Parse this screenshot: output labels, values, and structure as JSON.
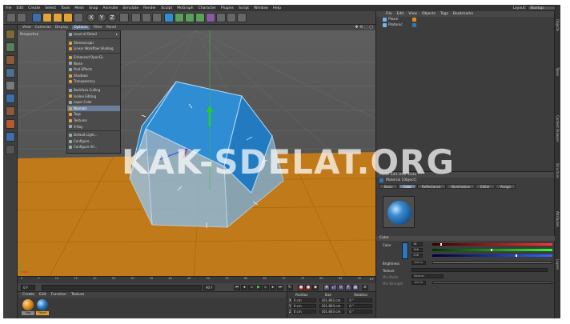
{
  "menubar": {
    "items": [
      "File",
      "Edit",
      "Create",
      "Select",
      "Tools",
      "Mesh",
      "Snap",
      "Animate",
      "Simulate",
      "Render",
      "Sculpt",
      "MoGraph",
      "Character",
      "Plugins",
      "Script",
      "Window",
      "Help"
    ],
    "layout_label": "Layout:",
    "layout_value": "Startup"
  },
  "toolbar": {
    "icons": [
      "undo-icon",
      "redo-icon",
      "select-icon",
      "move-icon",
      "scale-icon",
      "rotate-icon",
      "add-icon",
      "x-axis-icon",
      "y-axis-icon",
      "z-axis-icon",
      "coordinate-icon",
      "render-region-icon",
      "render-view-icon",
      "render-settings-icon",
      "cube-icon",
      "pen-icon",
      "subdivision-icon",
      "array-icon",
      "deformer-icon",
      "floor-icon",
      "camera-icon",
      "light-icon"
    ],
    "axis": [
      "X",
      "Y",
      "Z"
    ]
  },
  "viewport": {
    "menu": [
      "View",
      "Cameras",
      "Display",
      "Options",
      "Filter",
      "Panel"
    ],
    "active_menu": "Options",
    "label": "Perspective",
    "nav_icons": "✥ ⟲ ⬚ ▢"
  },
  "options_menu": {
    "items": [
      {
        "label": "Level of Detail",
        "check": false,
        "arrow": true,
        "sep_after": true
      },
      {
        "label": "Stereoscopic",
        "check": true,
        "sep_after": false
      },
      {
        "label": "Linear Workflow Shading",
        "check": true,
        "sep_after": true
      },
      {
        "label": "Enhanced OpenGL",
        "check": true,
        "sep_after": false
      },
      {
        "label": "Noise",
        "check": false,
        "sep_after": false
      },
      {
        "label": "Post Effects",
        "check": false,
        "sep_after": false
      },
      {
        "label": "Shadows",
        "check": true,
        "sep_after": false
      },
      {
        "label": "Transparency",
        "check": true,
        "sep_after": true
      },
      {
        "label": "Backface Culling",
        "check": false,
        "sep_after": false
      },
      {
        "label": "Isoline Editing",
        "check": true,
        "sep_after": false
      },
      {
        "label": "Layer Color",
        "check": false,
        "sep_after": false
      },
      {
        "label": "Normals",
        "check": true,
        "highlight": true,
        "sep_after": false
      },
      {
        "label": "Tags",
        "check": true,
        "sep_after": false
      },
      {
        "label": "Textures",
        "check": true,
        "sep_after": false
      },
      {
        "label": "X-Ray",
        "check": false,
        "sep_after": true
      },
      {
        "label": "Default Light...",
        "check": false,
        "sep_after": false
      },
      {
        "label": "Configure...",
        "check": false,
        "sep_after": false
      },
      {
        "label": "Configure All...",
        "check": false,
        "sep_after": false
      }
    ]
  },
  "timeline": {
    "ticks": [
      "0",
      "5",
      "10",
      "15",
      "20",
      "25",
      "30",
      "35",
      "40",
      "45",
      "50",
      "55",
      "60",
      "65",
      "70",
      "75",
      "80",
      "85",
      "90"
    ],
    "start_field": "0 F",
    "end_field": "90 F",
    "current_field": "0 F",
    "end2_field": "90 F",
    "current_frame_display": "0 F"
  },
  "material_manager": {
    "menu": [
      "Create",
      "Edit",
      "Function",
      "Texture"
    ],
    "materials": [
      {
        "label": "Mat",
        "color": "#e08a1e"
      },
      {
        "label": "Object",
        "color": "#2b78bf"
      }
    ]
  },
  "coordinates": {
    "headers": [
      "Position",
      "Size",
      "Rotation"
    ],
    "rows": [
      {
        "axis": "X",
        "pos": "0 cm",
        "size": "161.803 cm",
        "rot_label": "H",
        "rot": "0 °"
      },
      {
        "axis": "Y",
        "pos": "0 cm",
        "size": "161.803 cm",
        "rot_label": "P",
        "rot": "0 °"
      },
      {
        "axis": "Z",
        "pos": "0 cm",
        "size": "161.803 cm",
        "rot_label": "B",
        "rot": "0 °"
      }
    ]
  },
  "object_manager": {
    "menu": [
      "File",
      "Edit",
      "View",
      "Objects",
      "Tags",
      "Bookmarks"
    ],
    "objects": [
      {
        "label": "Plane",
        "icon_color": "#7cb3e6",
        "tag_color": "#e08a1e"
      },
      {
        "label": "Platonic",
        "icon_color": "#7cb3e6",
        "tag_color": "#2b78bf"
      }
    ]
  },
  "side_tabs": [
    "Objects",
    "Takes",
    "Content Browser",
    "Structure",
    "Attributes",
    "Layers"
  ],
  "attributes": {
    "mode": "Mode Edit User Data",
    "title": "Material [Object]",
    "tabs": [
      "Basic",
      "Color",
      "Reflectance",
      "Illumination",
      "Editor",
      "Assign"
    ],
    "active_tab": "Color",
    "section": "Color",
    "color_label": "Color",
    "r_value": "18",
    "g_value": "126",
    "b_value": "178",
    "r_frac": 0.07,
    "g_frac": 0.49,
    "b_frac": 0.7,
    "brightness_label": "Brightness",
    "brightness_value": "100 %",
    "texture_label": "Texture",
    "mix_mode_label": "Mix Mode",
    "mix_mode_value": "Normal",
    "mix_strength_label": "Mix Strength",
    "mix_strength_value": "100 %",
    "swatch_color": "#2b78bf"
  },
  "watermark": "KAK-SDELAT.ORG",
  "colors": {
    "floor": "#c07a1a",
    "solid": "#2f8dd4",
    "solid_dark": "#1a5a92",
    "accent": "#6b7f9c"
  }
}
